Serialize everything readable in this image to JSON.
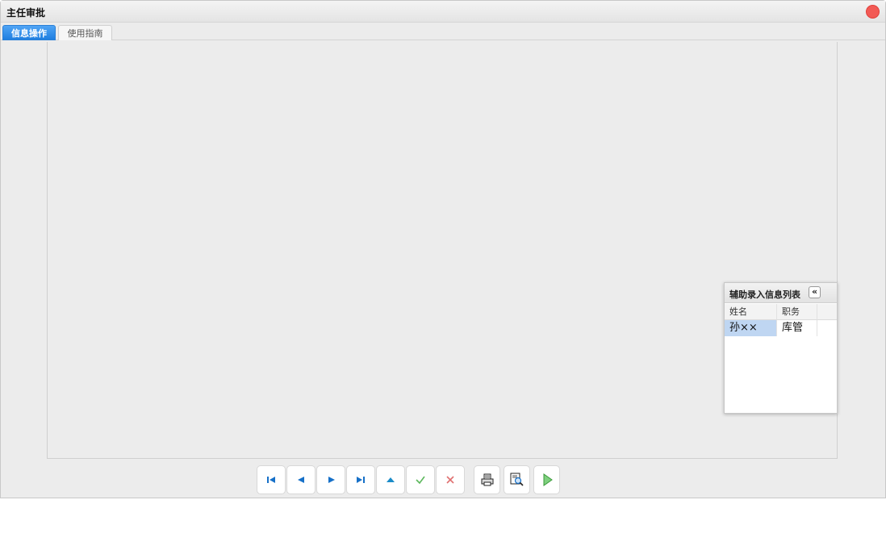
{
  "window": {
    "title": "主任审批",
    "close_icon": "close-icon"
  },
  "tabs": [
    {
      "label": "信息操作",
      "active": true
    },
    {
      "label": "使用指南",
      "active": false
    }
  ],
  "aux_panel": {
    "title": "辅助录入信息列表",
    "collapse_label": "«",
    "columns": [
      "姓名",
      "职务"
    ],
    "rows": [
      {
        "name": "孙××",
        "position": "库管"
      }
    ]
  },
  "toolbar": {
    "buttons": [
      {
        "name": "first-record-button",
        "icon": "first-icon"
      },
      {
        "name": "prev-record-button",
        "icon": "prev-icon"
      },
      {
        "name": "next-record-button",
        "icon": "next-icon"
      },
      {
        "name": "last-record-button",
        "icon": "last-icon"
      },
      {
        "name": "up-button",
        "icon": "up-icon"
      },
      {
        "name": "confirm-button",
        "icon": "check-icon"
      },
      {
        "name": "cancel-button",
        "icon": "x-icon"
      },
      {
        "name": "print-button",
        "icon": "printer-icon"
      },
      {
        "name": "print-preview-button",
        "icon": "print-preview-icon"
      },
      {
        "name": "run-button",
        "icon": "play-icon"
      }
    ]
  },
  "colors": {
    "tab_active": "#1f7fe0",
    "close": "#f25a55",
    "nav_blue": "#1670c8",
    "check_green": "#5cb85c",
    "x_red": "#e07070",
    "play_green": "#55c055",
    "row_selected": "#bfd6f2"
  }
}
